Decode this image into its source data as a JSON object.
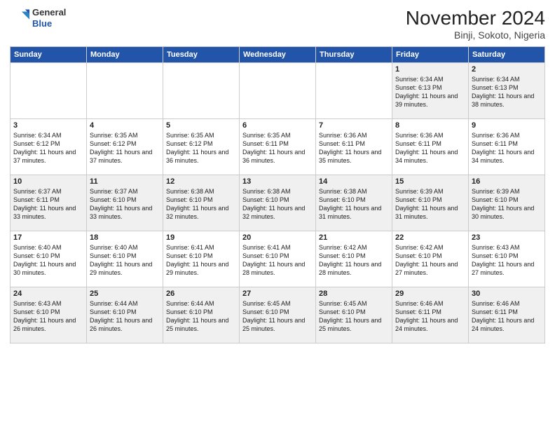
{
  "logo": {
    "line1": "General",
    "line2": "Blue"
  },
  "title": "November 2024",
  "subtitle": "Binji, Sokoto, Nigeria",
  "weekdays": [
    "Sunday",
    "Monday",
    "Tuesday",
    "Wednesday",
    "Thursday",
    "Friday",
    "Saturday"
  ],
  "weeks": [
    [
      {
        "day": "",
        "info": ""
      },
      {
        "day": "",
        "info": ""
      },
      {
        "day": "",
        "info": ""
      },
      {
        "day": "",
        "info": ""
      },
      {
        "day": "",
        "info": ""
      },
      {
        "day": "1",
        "info": "Sunrise: 6:34 AM\nSunset: 6:13 PM\nDaylight: 11 hours\nand 39 minutes."
      },
      {
        "day": "2",
        "info": "Sunrise: 6:34 AM\nSunset: 6:13 PM\nDaylight: 11 hours\nand 38 minutes."
      }
    ],
    [
      {
        "day": "3",
        "info": "Sunrise: 6:34 AM\nSunset: 6:12 PM\nDaylight: 11 hours\nand 37 minutes."
      },
      {
        "day": "4",
        "info": "Sunrise: 6:35 AM\nSunset: 6:12 PM\nDaylight: 11 hours\nand 37 minutes."
      },
      {
        "day": "5",
        "info": "Sunrise: 6:35 AM\nSunset: 6:12 PM\nDaylight: 11 hours\nand 36 minutes."
      },
      {
        "day": "6",
        "info": "Sunrise: 6:35 AM\nSunset: 6:11 PM\nDaylight: 11 hours\nand 36 minutes."
      },
      {
        "day": "7",
        "info": "Sunrise: 6:36 AM\nSunset: 6:11 PM\nDaylight: 11 hours\nand 35 minutes."
      },
      {
        "day": "8",
        "info": "Sunrise: 6:36 AM\nSunset: 6:11 PM\nDaylight: 11 hours\nand 34 minutes."
      },
      {
        "day": "9",
        "info": "Sunrise: 6:36 AM\nSunset: 6:11 PM\nDaylight: 11 hours\nand 34 minutes."
      }
    ],
    [
      {
        "day": "10",
        "info": "Sunrise: 6:37 AM\nSunset: 6:11 PM\nDaylight: 11 hours\nand 33 minutes."
      },
      {
        "day": "11",
        "info": "Sunrise: 6:37 AM\nSunset: 6:10 PM\nDaylight: 11 hours\nand 33 minutes."
      },
      {
        "day": "12",
        "info": "Sunrise: 6:38 AM\nSunset: 6:10 PM\nDaylight: 11 hours\nand 32 minutes."
      },
      {
        "day": "13",
        "info": "Sunrise: 6:38 AM\nSunset: 6:10 PM\nDaylight: 11 hours\nand 32 minutes."
      },
      {
        "day": "14",
        "info": "Sunrise: 6:38 AM\nSunset: 6:10 PM\nDaylight: 11 hours\nand 31 minutes."
      },
      {
        "day": "15",
        "info": "Sunrise: 6:39 AM\nSunset: 6:10 PM\nDaylight: 11 hours\nand 31 minutes."
      },
      {
        "day": "16",
        "info": "Sunrise: 6:39 AM\nSunset: 6:10 PM\nDaylight: 11 hours\nand 30 minutes."
      }
    ],
    [
      {
        "day": "17",
        "info": "Sunrise: 6:40 AM\nSunset: 6:10 PM\nDaylight: 11 hours\nand 30 minutes."
      },
      {
        "day": "18",
        "info": "Sunrise: 6:40 AM\nSunset: 6:10 PM\nDaylight: 11 hours\nand 29 minutes."
      },
      {
        "day": "19",
        "info": "Sunrise: 6:41 AM\nSunset: 6:10 PM\nDaylight: 11 hours\nand 29 minutes."
      },
      {
        "day": "20",
        "info": "Sunrise: 6:41 AM\nSunset: 6:10 PM\nDaylight: 11 hours\nand 28 minutes."
      },
      {
        "day": "21",
        "info": "Sunrise: 6:42 AM\nSunset: 6:10 PM\nDaylight: 11 hours\nand 28 minutes."
      },
      {
        "day": "22",
        "info": "Sunrise: 6:42 AM\nSunset: 6:10 PM\nDaylight: 11 hours\nand 27 minutes."
      },
      {
        "day": "23",
        "info": "Sunrise: 6:43 AM\nSunset: 6:10 PM\nDaylight: 11 hours\nand 27 minutes."
      }
    ],
    [
      {
        "day": "24",
        "info": "Sunrise: 6:43 AM\nSunset: 6:10 PM\nDaylight: 11 hours\nand 26 minutes."
      },
      {
        "day": "25",
        "info": "Sunrise: 6:44 AM\nSunset: 6:10 PM\nDaylight: 11 hours\nand 26 minutes."
      },
      {
        "day": "26",
        "info": "Sunrise: 6:44 AM\nSunset: 6:10 PM\nDaylight: 11 hours\nand 25 minutes."
      },
      {
        "day": "27",
        "info": "Sunrise: 6:45 AM\nSunset: 6:10 PM\nDaylight: 11 hours\nand 25 minutes."
      },
      {
        "day": "28",
        "info": "Sunrise: 6:45 AM\nSunset: 6:10 PM\nDaylight: 11 hours\nand 25 minutes."
      },
      {
        "day": "29",
        "info": "Sunrise: 6:46 AM\nSunset: 6:11 PM\nDaylight: 11 hours\nand 24 minutes."
      },
      {
        "day": "30",
        "info": "Sunrise: 6:46 AM\nSunset: 6:11 PM\nDaylight: 11 hours\nand 24 minutes."
      }
    ]
  ]
}
